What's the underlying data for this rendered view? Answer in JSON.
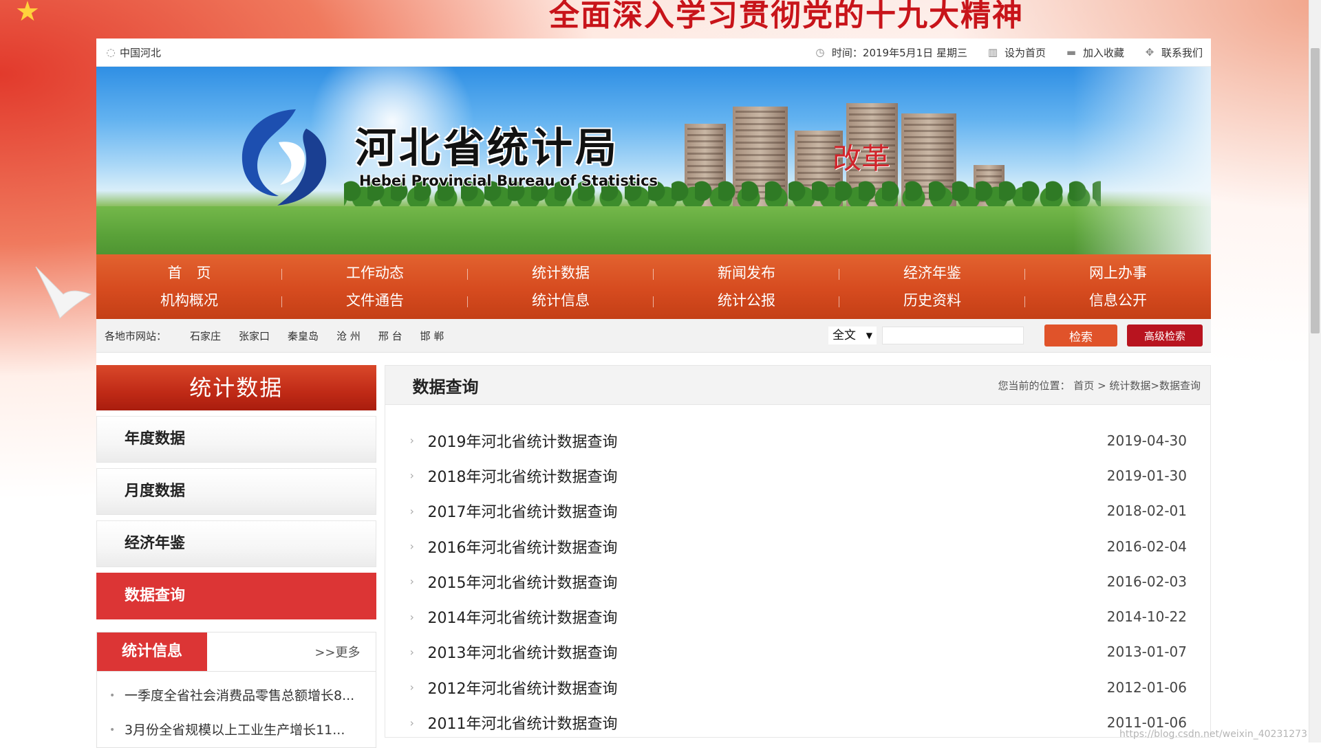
{
  "background": {
    "slogan": "全面深入学习贯彻党的十九大精神"
  },
  "topbar": {
    "region": "中国河北",
    "time": "时间：2019年5月1日 星期三",
    "set_home": "设为首页",
    "add_favorite": "加入收藏",
    "contact": "联系我们"
  },
  "banner": {
    "title": "河北省统计局",
    "subtitle": "Hebei Provincial Bureau of Statistics",
    "reform": "改革"
  },
  "nav": {
    "items": [
      "首　页",
      "工作动态",
      "统计数据",
      "新闻发布",
      "经济年鉴",
      "网上办事",
      "机构概况",
      "文件通告",
      "统计信息",
      "统计公报",
      "历史资料",
      "信息公开"
    ]
  },
  "citybar": {
    "label": "各地市网站：",
    "cities": [
      "石家庄",
      "张家口",
      "秦皇岛",
      "沧 州",
      "邢 台",
      "邯 郸"
    ],
    "select_value": "全文",
    "search_btn": "检索",
    "adv_btn": "高级检索"
  },
  "sidebar": {
    "title": "统计数据",
    "items": [
      "年度数据",
      "月度数据",
      "经济年鉴",
      "数据查询"
    ],
    "active_index": 3,
    "info_tab": "统计信息",
    "more": ">>更多",
    "info_items": [
      "一季度全省社会消费品零售总额增长8...",
      "3月份全省规模以上工业生产增长11..."
    ]
  },
  "content": {
    "title": "数据查询",
    "crumb_prefix": "您当前的位置：",
    "crumb_home": "首页",
    "crumb_sep": ">",
    "crumb_path": "统计数据>数据查询",
    "rows": [
      {
        "title": "2019年河北省统计数据查询",
        "date": "2019-04-30"
      },
      {
        "title": "2018年河北省统计数据查询",
        "date": "2019-01-30"
      },
      {
        "title": "2017年河北省统计数据查询",
        "date": "2018-02-01"
      },
      {
        "title": "2016年河北省统计数据查询",
        "date": "2016-02-04"
      },
      {
        "title": "2015年河北省统计数据查询",
        "date": "2016-02-03"
      },
      {
        "title": "2014年河北省统计数据查询",
        "date": "2014-10-22"
      },
      {
        "title": "2013年河北省统计数据查询",
        "date": "2013-01-07"
      },
      {
        "title": "2012年河北省统计数据查询",
        "date": "2012-01-06"
      },
      {
        "title": "2011年河北省统计数据查询",
        "date": "2011-01-06"
      }
    ]
  },
  "watermark": "https://blog.csdn.net/weixin_40231273",
  "colors": {
    "nav_bg": "#d64b1f",
    "accent_red": "#dc3535",
    "search_btn": "#e0532a",
    "adv_btn": "#b8141f"
  }
}
